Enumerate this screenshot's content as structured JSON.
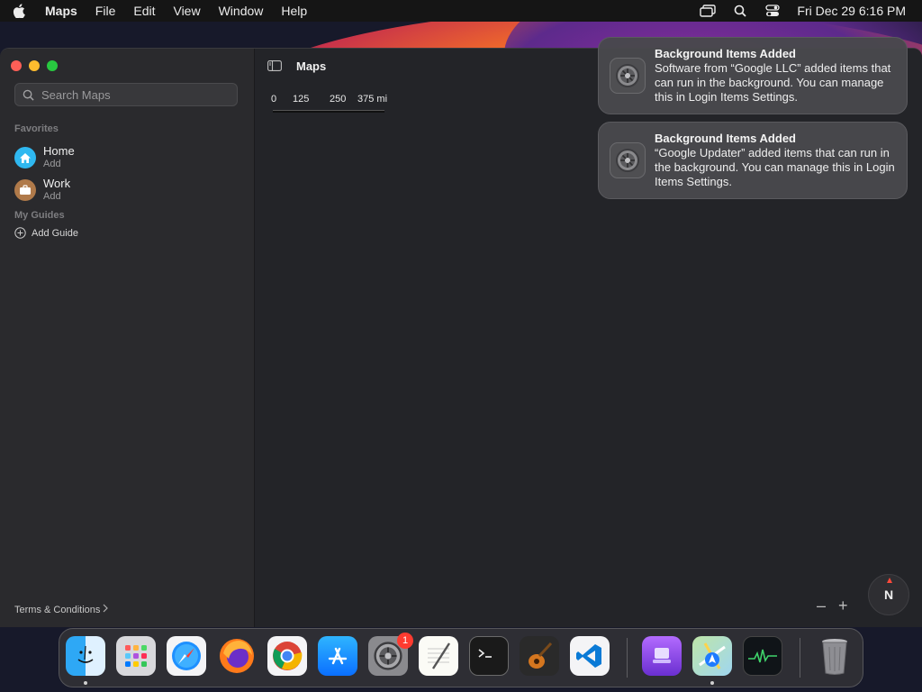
{
  "menubar": {
    "app_name": "Maps",
    "items": [
      "File",
      "Edit",
      "View",
      "Window",
      "Help"
    ],
    "datetime": "Fri Dec 29  6:16 PM"
  },
  "window": {
    "title": "Maps",
    "search": {
      "placeholder": "Search Maps"
    },
    "favorites_header": "Favorites",
    "favorites": [
      {
        "name": "Home",
        "sub": "Add",
        "color": "#2fb8f0",
        "icon": "house-icon"
      },
      {
        "name": "Work",
        "sub": "Add",
        "color": "#b07a4a",
        "icon": "briefcase-icon"
      }
    ],
    "guides_header": "My Guides",
    "add_guide": "Add Guide",
    "terms": "Terms & Conditions",
    "scale": {
      "labels": [
        "0",
        "125",
        "250",
        "375 mi"
      ]
    },
    "compass_label": "N",
    "zoom_out": "–",
    "zoom_in": "+"
  },
  "notifications": [
    {
      "title": "Background Items Added",
      "body": "Software from “Google LLC” added items that can run in the background. You can manage this in Login Items Settings."
    },
    {
      "title": "Background Items Added",
      "body": "“Google Updater” added items that can run in the background. You can manage this in Login Items Settings."
    }
  ],
  "dock": {
    "apps": [
      {
        "name": "Finder",
        "icon": "finder-icon",
        "running": true
      },
      {
        "name": "Launchpad",
        "icon": "launchpad-icon",
        "running": false
      },
      {
        "name": "Safari",
        "icon": "safari-icon",
        "running": false
      },
      {
        "name": "Firefox",
        "icon": "firefox-icon",
        "running": false
      },
      {
        "name": "Chrome",
        "icon": "chrome-icon",
        "running": false
      },
      {
        "name": "App Store",
        "icon": "app-store-icon",
        "running": false
      },
      {
        "name": "System Settings",
        "icon": "system-settings-icon",
        "running": false,
        "badge": "1"
      },
      {
        "name": "TextEdit",
        "icon": "textedit-icon",
        "running": false
      },
      {
        "name": "Terminal",
        "icon": "terminal-icon",
        "running": false
      },
      {
        "name": "GarageBand",
        "icon": "garageband-icon",
        "running": false
      },
      {
        "name": "Visual Studio Code",
        "icon": "vscode-icon",
        "running": false
      },
      {
        "name": "Apple Configurator",
        "icon": "configurator-icon",
        "running": false
      },
      {
        "name": "Maps",
        "icon": "maps-icon",
        "running": true
      },
      {
        "name": "Activity Monitor",
        "icon": "activity-monitor-icon",
        "running": false
      },
      {
        "name": "Trash",
        "icon": "trash-icon",
        "running": false
      }
    ]
  }
}
